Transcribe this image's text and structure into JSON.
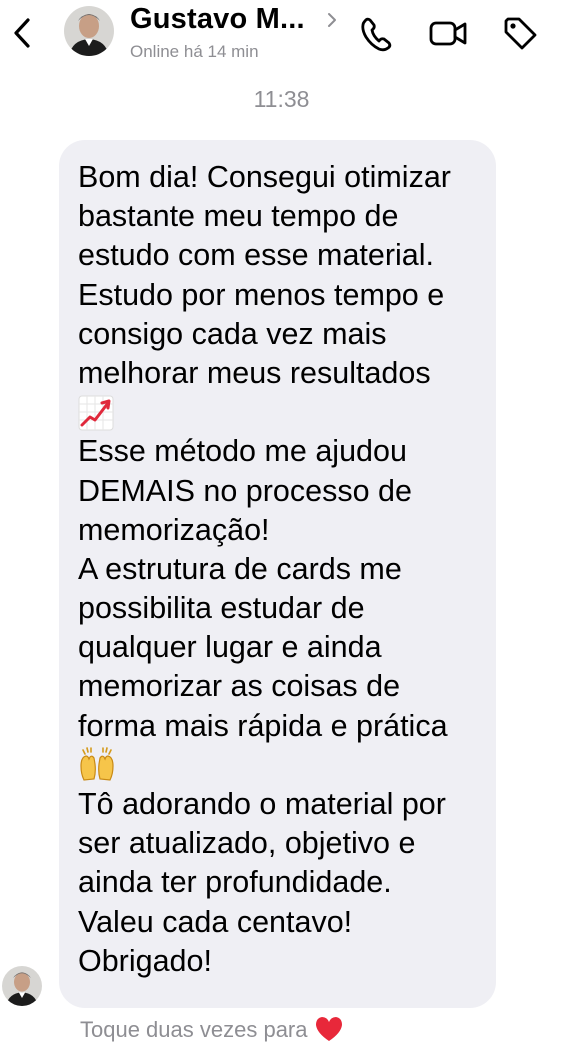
{
  "header": {
    "contact_name": "Gustavo M...",
    "status": "Online há 14 min",
    "icons": {
      "back": "chevron-left-icon",
      "call": "phone-icon",
      "video": "video-camera-icon",
      "tag": "tag-icon"
    }
  },
  "conversation": {
    "timestamp": "11:38",
    "message": {
      "lines": [
        "Bom dia! Consegui otimizar",
        "bastante meu tempo de",
        "estudo com esse material.",
        "Estudo por menos tempo e",
        "consigo cada vez mais",
        "melhorar meus resultados",
        "Esse método me ajudou",
        "DEMAIS no processo de",
        "memorização!",
        "A estrutura de cards me",
        "possibilita estudar de",
        "qualquer lugar e ainda",
        "memorizar as coisas de",
        "forma mais rápida e prática",
        "Tô adorando o material por",
        "ser atualizado, objetivo e",
        "ainda ter profundidade.",
        "Valeu cada centavo!",
        "Obrigado!"
      ],
      "emojis": [
        "chart-increasing-emoji",
        "raising-hands-emoji"
      ]
    },
    "hint": "Toque duas vezes para"
  },
  "colors": {
    "bubble": "#efeff4",
    "secondary_text": "#8e8e93",
    "heart": "#e8283a"
  }
}
